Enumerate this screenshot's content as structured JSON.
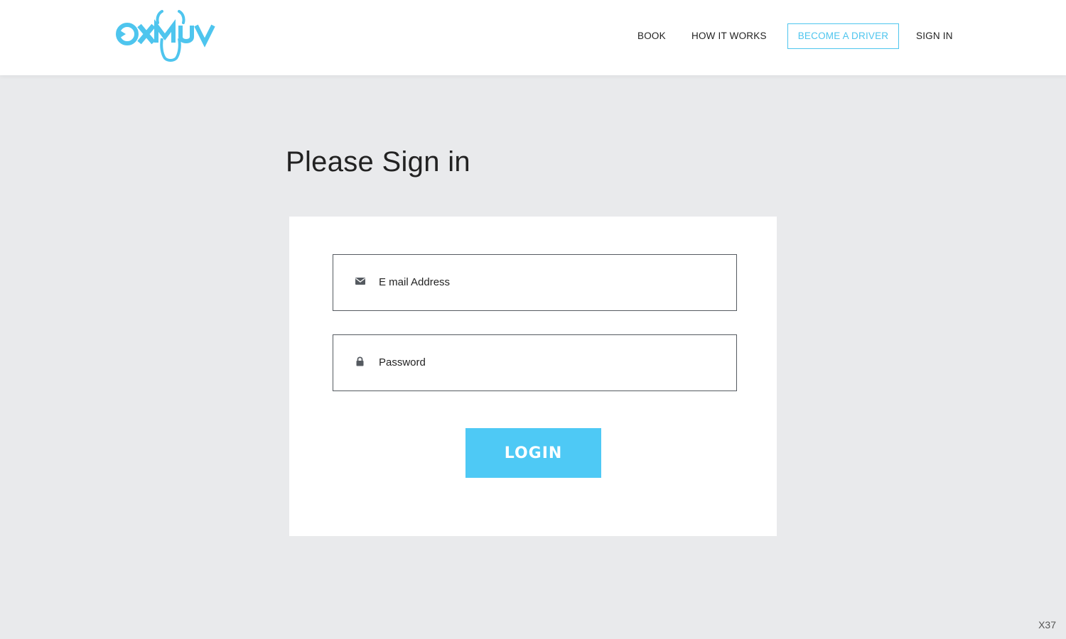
{
  "brand": {
    "logo_text": "OXMUV",
    "accent_color": "#4ec5ee"
  },
  "nav": {
    "book": "BOOK",
    "how_it_works": "HOW IT WORKS",
    "become_driver": "BECOME A DRIVER",
    "sign_in": "SIGN IN"
  },
  "page": {
    "title": "Please Sign in"
  },
  "form": {
    "email": {
      "placeholder": "E mail Address",
      "value": "",
      "icon": "envelope-icon"
    },
    "password": {
      "placeholder": "Password",
      "value": "",
      "icon": "lock-icon"
    },
    "login_label": "LOGIN",
    "login_color": "#4ec9f5"
  },
  "footer": {
    "corner_tag": "X37"
  }
}
